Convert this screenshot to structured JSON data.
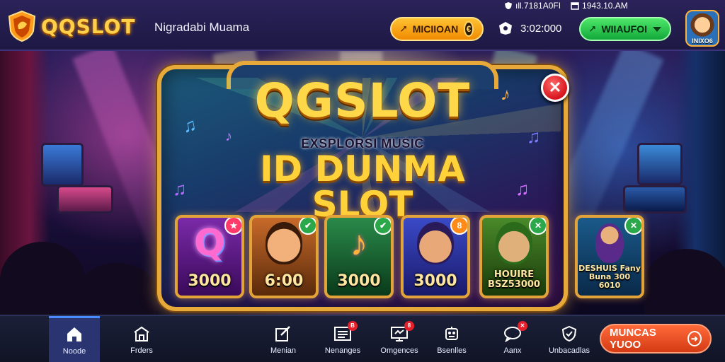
{
  "header": {
    "logo_text": "QQSLOT",
    "site_title": "Nigradabi Muama",
    "status_signal": "ıll.7181A0FI",
    "status_time": "1943.10.AM",
    "promo_button_label": "MICIIOAN",
    "balance": "3:02:000",
    "deposit_button_label": "WIIAUFOI",
    "avatar_name": "INIXO6"
  },
  "promo": {
    "title": "QGSLOT",
    "subtitle": "EXSPLORSI MUSIC",
    "heading": "ID DUNMA SLOT"
  },
  "games": [
    {
      "label": "3000",
      "badge": "★",
      "icon": "q-logo-icon"
    },
    {
      "label": "6:00",
      "badge": "✔",
      "icon": "guitarist-icon"
    },
    {
      "label": "3000",
      "badge": "✔",
      "icon": "music-note-icon"
    },
    {
      "label": "3000",
      "badge": "8",
      "icon": "singer-icon"
    },
    {
      "label": "HOUIRE BSZ53000",
      "badge": "✕",
      "icon": "elf-icon"
    },
    {
      "label": "DESHUIS Fany Buna 300 6010",
      "badge": "✕",
      "icon": "dancer-icon"
    }
  ],
  "nav": {
    "items": [
      {
        "label": "Noode",
        "icon": "home-icon",
        "active": true
      },
      {
        "label": "Frders",
        "icon": "building-icon",
        "active": false
      },
      {
        "label": "Menian",
        "icon": "edit-icon",
        "active": false
      },
      {
        "label": "Nenanges",
        "icon": "list-icon",
        "active": false,
        "badge": "B"
      },
      {
        "label": "Omgences",
        "icon": "monitor-icon",
        "active": false,
        "badge": "8"
      },
      {
        "label": "Bsenlles",
        "icon": "robot-icon",
        "active": false
      },
      {
        "label": "Aanx",
        "icon": "chat-icon",
        "active": false,
        "badge": "✕"
      },
      {
        "label": "Unbacadlas",
        "icon": "shield-icon",
        "active": false
      }
    ],
    "cta_label": "MUNCAS YUOO"
  },
  "colors": {
    "accent_gold": "#ffd04a",
    "cta_orange": "#e24a1c",
    "deposit_green": "#1fba46",
    "close_red": "#d6141c"
  }
}
